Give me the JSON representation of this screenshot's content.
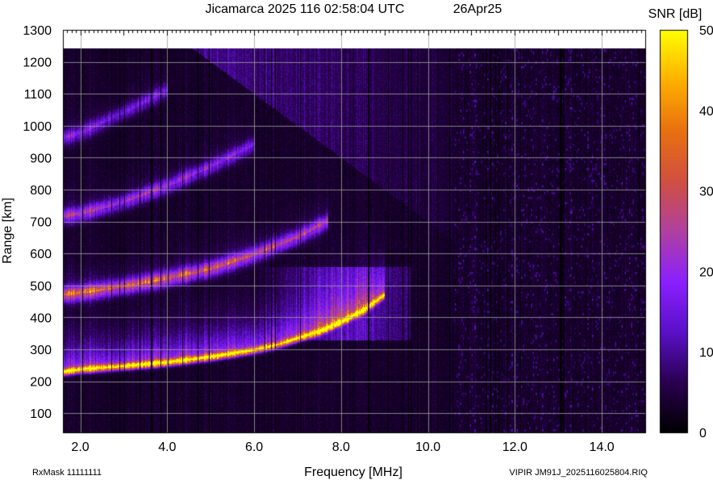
{
  "chart_data": {
    "type": "heatmap",
    "title": "Jicamarca 2025 116 02:58:04 UTC",
    "date": "26Apr25",
    "xlabel": "Frequency [MHz]",
    "ylabel": "Range [km]",
    "colorbar_label": "SNR [dB]",
    "xlim": [
      1.6,
      15.0
    ],
    "ylim": [
      40,
      1300
    ],
    "x_ticks": [
      2.0,
      4.0,
      6.0,
      8.0,
      10.0,
      12.0,
      14.0
    ],
    "x_tick_labels": [
      "2.0",
      "4.0",
      "6.0",
      "8.0",
      "10.0",
      "12.0",
      "14.0"
    ],
    "y_ticks": [
      100,
      200,
      300,
      400,
      500,
      600,
      700,
      800,
      900,
      1000,
      1100,
      1200,
      1300
    ],
    "y_tick_labels": [
      "100",
      "200",
      "300",
      "400",
      "500",
      "600",
      "700",
      "800",
      "900",
      "1000",
      "1100",
      "1200",
      "1300"
    ],
    "colorbar_range": [
      0,
      50
    ],
    "colorbar_ticks": [
      0,
      10,
      20,
      30,
      40,
      50
    ],
    "colorbar_tick_labels": [
      "0",
      "10",
      "20",
      "30",
      "40",
      "50"
    ],
    "colormap": [
      "#000000",
      "#2a0050",
      "#5a10c8",
      "#8a20ff",
      "#b040a0",
      "#d05040",
      "#e87010",
      "#ffb000",
      "#ffff00"
    ],
    "grid": true,
    "traces": [
      {
        "name": "F-layer echo",
        "x": [
          1.6,
          2.0,
          3.0,
          4.0,
          5.0,
          6.0,
          6.5,
          7.0,
          7.5,
          8.0,
          8.5,
          9.0
        ],
        "y": [
          228,
          236,
          246,
          258,
          275,
          297,
          312,
          333,
          355,
          385,
          420,
          470
        ],
        "snr": [
          40,
          42,
          43,
          44,
          43,
          40,
          36,
          38,
          42,
          45,
          40,
          35
        ]
      },
      {
        "name": "second-hop echo",
        "x": [
          1.6,
          2.0,
          3.0,
          4.0,
          5.0,
          6.0,
          7.0,
          7.7
        ],
        "y": [
          470,
          475,
          495,
          520,
          550,
          595,
          650,
          700
        ],
        "snr": [
          24,
          25,
          23,
          22,
          21,
          19,
          17,
          15
        ]
      },
      {
        "name": "third-hop echo",
        "x": [
          1.6,
          2.0,
          3.0,
          4.0,
          5.0,
          6.0
        ],
        "y": [
          715,
          722,
          760,
          810,
          870,
          940
        ],
        "snr": [
          16,
          16,
          15,
          14,
          12,
          10
        ]
      },
      {
        "name": "fourth-hop echo",
        "x": [
          1.6,
          2.0,
          3.0,
          4.0
        ],
        "y": [
          960,
          975,
          1040,
          1110
        ],
        "snr": [
          12,
          11,
          10,
          9
        ]
      }
    ]
  },
  "footer": {
    "left": "RxMask 11111111",
    "right": "VIPIR  JM91J_2025116025804.RIQ"
  }
}
